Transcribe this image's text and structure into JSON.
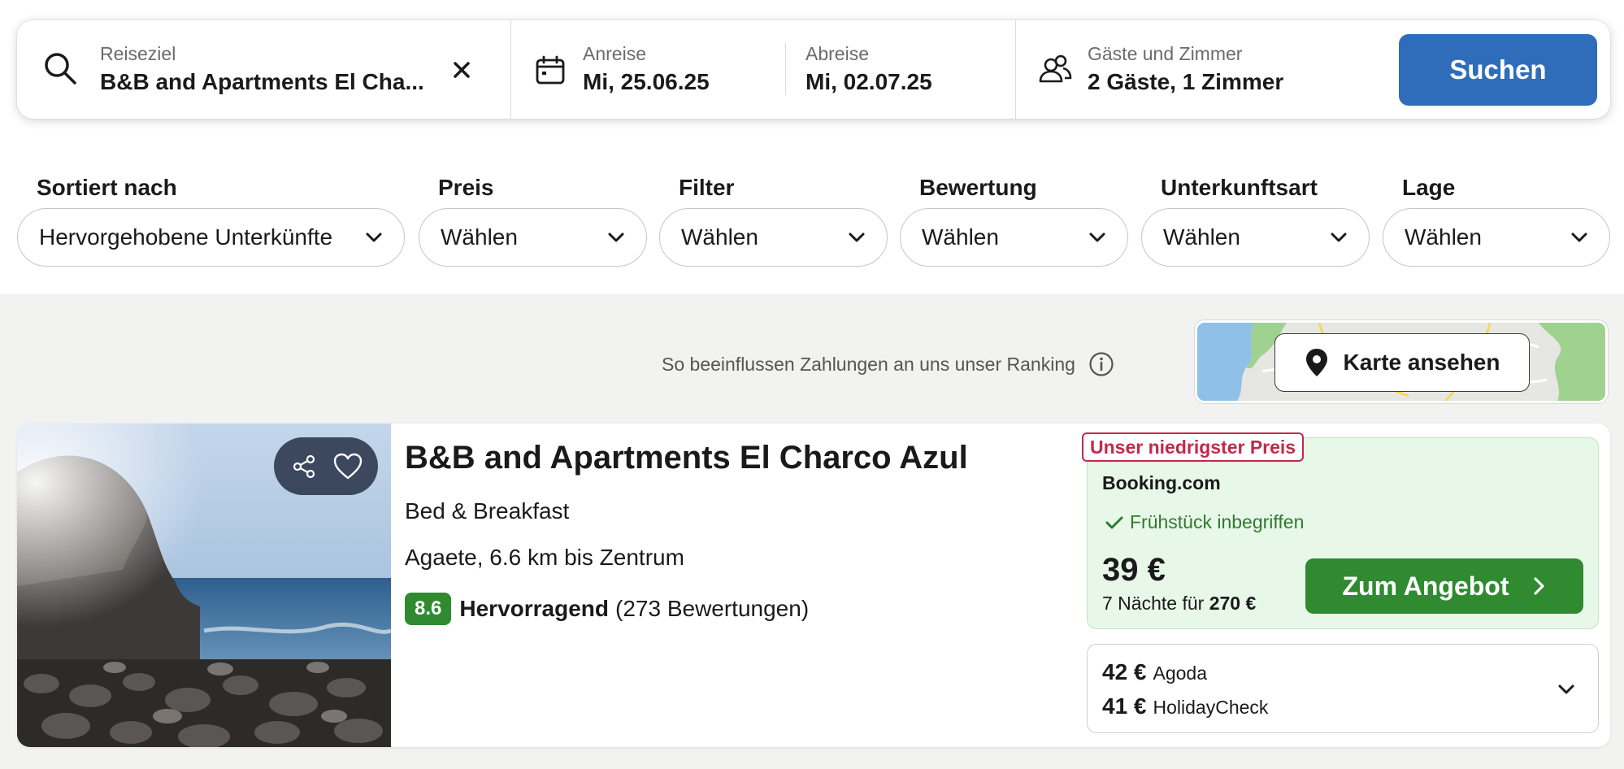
{
  "search": {
    "destination_label": "Reiseziel",
    "destination_value": "B&B and Apartments El Cha...",
    "checkin_label": "Anreise",
    "checkin_value": "Mi, 25.06.25",
    "checkout_label": "Abreise",
    "checkout_value": "Mi, 02.07.25",
    "guests_label": "Gäste und Zimmer",
    "guests_value": "2 Gäste, 1 Zimmer",
    "search_button": "Suchen",
    "accent_color": "#2f6dbb"
  },
  "filters": [
    {
      "label": "Sortiert nach",
      "value": "Hervorgehobene Unterkünfte"
    },
    {
      "label": "Preis",
      "value": "Wählen"
    },
    {
      "label": "Filter",
      "value": "Wählen"
    },
    {
      "label": "Bewertung",
      "value": "Wählen"
    },
    {
      "label": "Unterkunftsart",
      "value": "Wählen"
    },
    {
      "label": "Lage",
      "value": "Wählen"
    }
  ],
  "ranking_note": "So beeinflussen Zahlungen an uns unser Ranking",
  "map_button": "Karte ansehen",
  "hotel": {
    "name": "B&B and Apartments El Charco Azul",
    "type": "Bed & Breakfast",
    "location": "Agaete, 6.6 km bis Zentrum",
    "score": "8.6",
    "rating_word": "Hervorragend",
    "review_count": "(273 Bewertungen)",
    "best_tag": "Unser niedrigster Preis",
    "best_offer": {
      "provider": "Booking.com",
      "amenity": "Frühstück inbegriffen",
      "price": "39 €",
      "nights_text": "7 Nächte für",
      "total": "270 €",
      "button": "Zum Angebot"
    },
    "other_offers": [
      {
        "price": "42 €",
        "provider": "Agoda"
      },
      {
        "price": "41 €",
        "provider": "HolidayCheck"
      }
    ],
    "colors": {
      "score_green": "#2f8a30",
      "tag_red": "#c3284c",
      "offer_bg": "#e8f8e8"
    }
  }
}
